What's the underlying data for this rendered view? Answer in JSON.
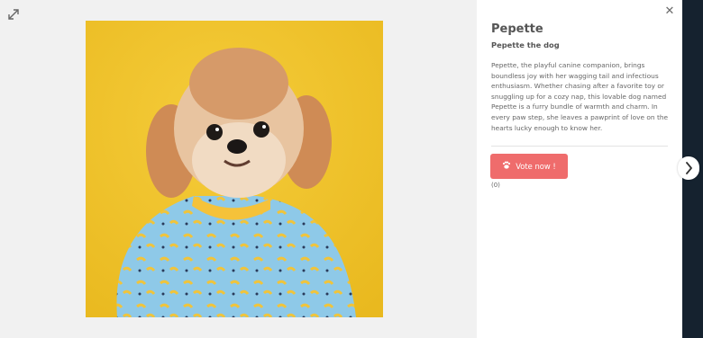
{
  "pet": {
    "name": "Pepette",
    "subtitle": "Pepette the dog",
    "description": "Pepette, the playful canine companion, brings boundless joy with her wagging tail and infectious enthusiasm. Whether chasing after a favorite toy or snuggling up for a cozy nap, this lovable dog named Pepette is a furry bundle of warmth and charm. In every paw step, she leaves a pawprint of love on the hearts lucky enough to know her."
  },
  "vote": {
    "label": "Vote now !",
    "count": "(0)"
  },
  "icons": {
    "expand": "expand-icon",
    "close": "close-icon",
    "paw": "paw-icon",
    "next": "chevron-right-icon"
  },
  "colors": {
    "vote_button": "#ef6c6c",
    "photo_background": "#f1c12a",
    "right_strip": "#15222f"
  }
}
